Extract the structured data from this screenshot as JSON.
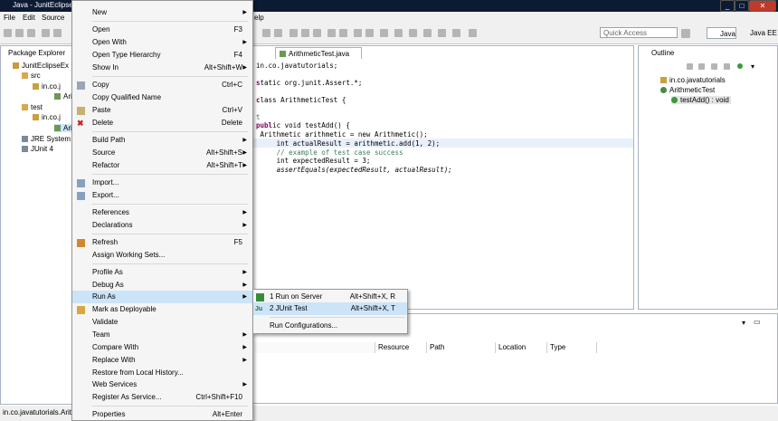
{
  "window": {
    "title": "Java - JunitEclipseEx"
  },
  "menubar": {
    "file": "File",
    "edit": "Edit",
    "source": "Source",
    "help": "elp"
  },
  "toolbar": {
    "quick_access": "Quick Access",
    "perspective_java": "Java",
    "perspective_javaee": "Java EE"
  },
  "package_explorer": {
    "title": "Package Explorer",
    "items": [
      "JunitEclipseEx",
      "src",
      "in.co.j",
      "Ari",
      "test",
      "in.co.j",
      "Ari",
      "JRE System",
      "JUnit 4"
    ]
  },
  "editor": {
    "tab": "ArithmeticTest.java",
    "lines": [
      "in.co.javatutorials;",
      "",
      "tatic org.junit.Assert.*;",
      "",
      "lass ArithmeticTest {",
      "",
      "t",
      "ic void testAdd() {",
      " Arithmetic arithmetic = new Arithmetic();",
      "     int actualResult = arithmetic.add(1, 2);",
      "     // example of test case success",
      "     int expectedResult = 3;",
      "     assertEquals(expectedResult, actualResult);"
    ]
  },
  "outline": {
    "title": "Outline",
    "items": [
      "in.co.javatutorials",
      "ArithmeticTest",
      "testAdd() : void"
    ]
  },
  "bottom_table": {
    "headers": [
      "Resource",
      "Path",
      "Location",
      "Type"
    ]
  },
  "status_bar": {
    "text": "in.co.javatutorials.Arith"
  },
  "context_menu": {
    "items": [
      {
        "label": "New",
        "shortcut": "",
        "submenu": true
      },
      {
        "label": "Open",
        "shortcut": "F3",
        "submenu": false
      },
      {
        "label": "Open With",
        "shortcut": "",
        "submenu": true
      },
      {
        "label": "Open Type Hierarchy",
        "shortcut": "F4",
        "submenu": false
      },
      {
        "label": "Show In",
        "shortcut": "Alt+Shift+W",
        "submenu": true
      },
      {
        "label": "Copy",
        "shortcut": "Ctrl+C",
        "submenu": false
      },
      {
        "label": "Copy Qualified Name",
        "shortcut": "",
        "submenu": false
      },
      {
        "label": "Paste",
        "shortcut": "Ctrl+V",
        "submenu": false
      },
      {
        "label": "Delete",
        "shortcut": "Delete",
        "submenu": false
      },
      {
        "label": "Build Path",
        "shortcut": "",
        "submenu": true
      },
      {
        "label": "Source",
        "shortcut": "Alt+Shift+S",
        "submenu": true
      },
      {
        "label": "Refactor",
        "shortcut": "Alt+Shift+T",
        "submenu": true
      },
      {
        "label": "Import...",
        "shortcut": "",
        "submenu": false
      },
      {
        "label": "Export...",
        "shortcut": "",
        "submenu": false
      },
      {
        "label": "References",
        "shortcut": "",
        "submenu": true
      },
      {
        "label": "Declarations",
        "shortcut": "",
        "submenu": true
      },
      {
        "label": "Refresh",
        "shortcut": "F5",
        "submenu": false
      },
      {
        "label": "Assign Working Sets...",
        "shortcut": "",
        "submenu": false
      },
      {
        "label": "Profile As",
        "shortcut": "",
        "submenu": true
      },
      {
        "label": "Debug As",
        "shortcut": "",
        "submenu": true
      },
      {
        "label": "Run As",
        "shortcut": "",
        "submenu": true
      },
      {
        "label": "Mark as Deployable",
        "shortcut": "",
        "submenu": false
      },
      {
        "label": "Validate",
        "shortcut": "",
        "submenu": false
      },
      {
        "label": "Team",
        "shortcut": "",
        "submenu": true
      },
      {
        "label": "Compare With",
        "shortcut": "",
        "submenu": true
      },
      {
        "label": "Replace With",
        "shortcut": "",
        "submenu": true
      },
      {
        "label": "Restore from Local History...",
        "shortcut": "",
        "submenu": false
      },
      {
        "label": "Web Services",
        "shortcut": "",
        "submenu": true
      },
      {
        "label": "Register As Service...",
        "shortcut": "Ctrl+Shift+F10",
        "submenu": false
      },
      {
        "label": "Properties",
        "shortcut": "Alt+Enter",
        "submenu": false
      }
    ]
  },
  "run_as_submenu": {
    "items": [
      {
        "label": "1 Run on Server",
        "shortcut": "Alt+Shift+X, R"
      },
      {
        "label": "2 JUnit Test",
        "shortcut": "Alt+Shift+X, T"
      },
      {
        "label": "Run Configurations...",
        "shortcut": ""
      }
    ]
  },
  "colors": {
    "title_bar": "#0d1a33",
    "selection": "#cce4f7",
    "keyword": "#7f0055",
    "comment": "#3f7f5f",
    "highlight": "#f2e9b0"
  }
}
